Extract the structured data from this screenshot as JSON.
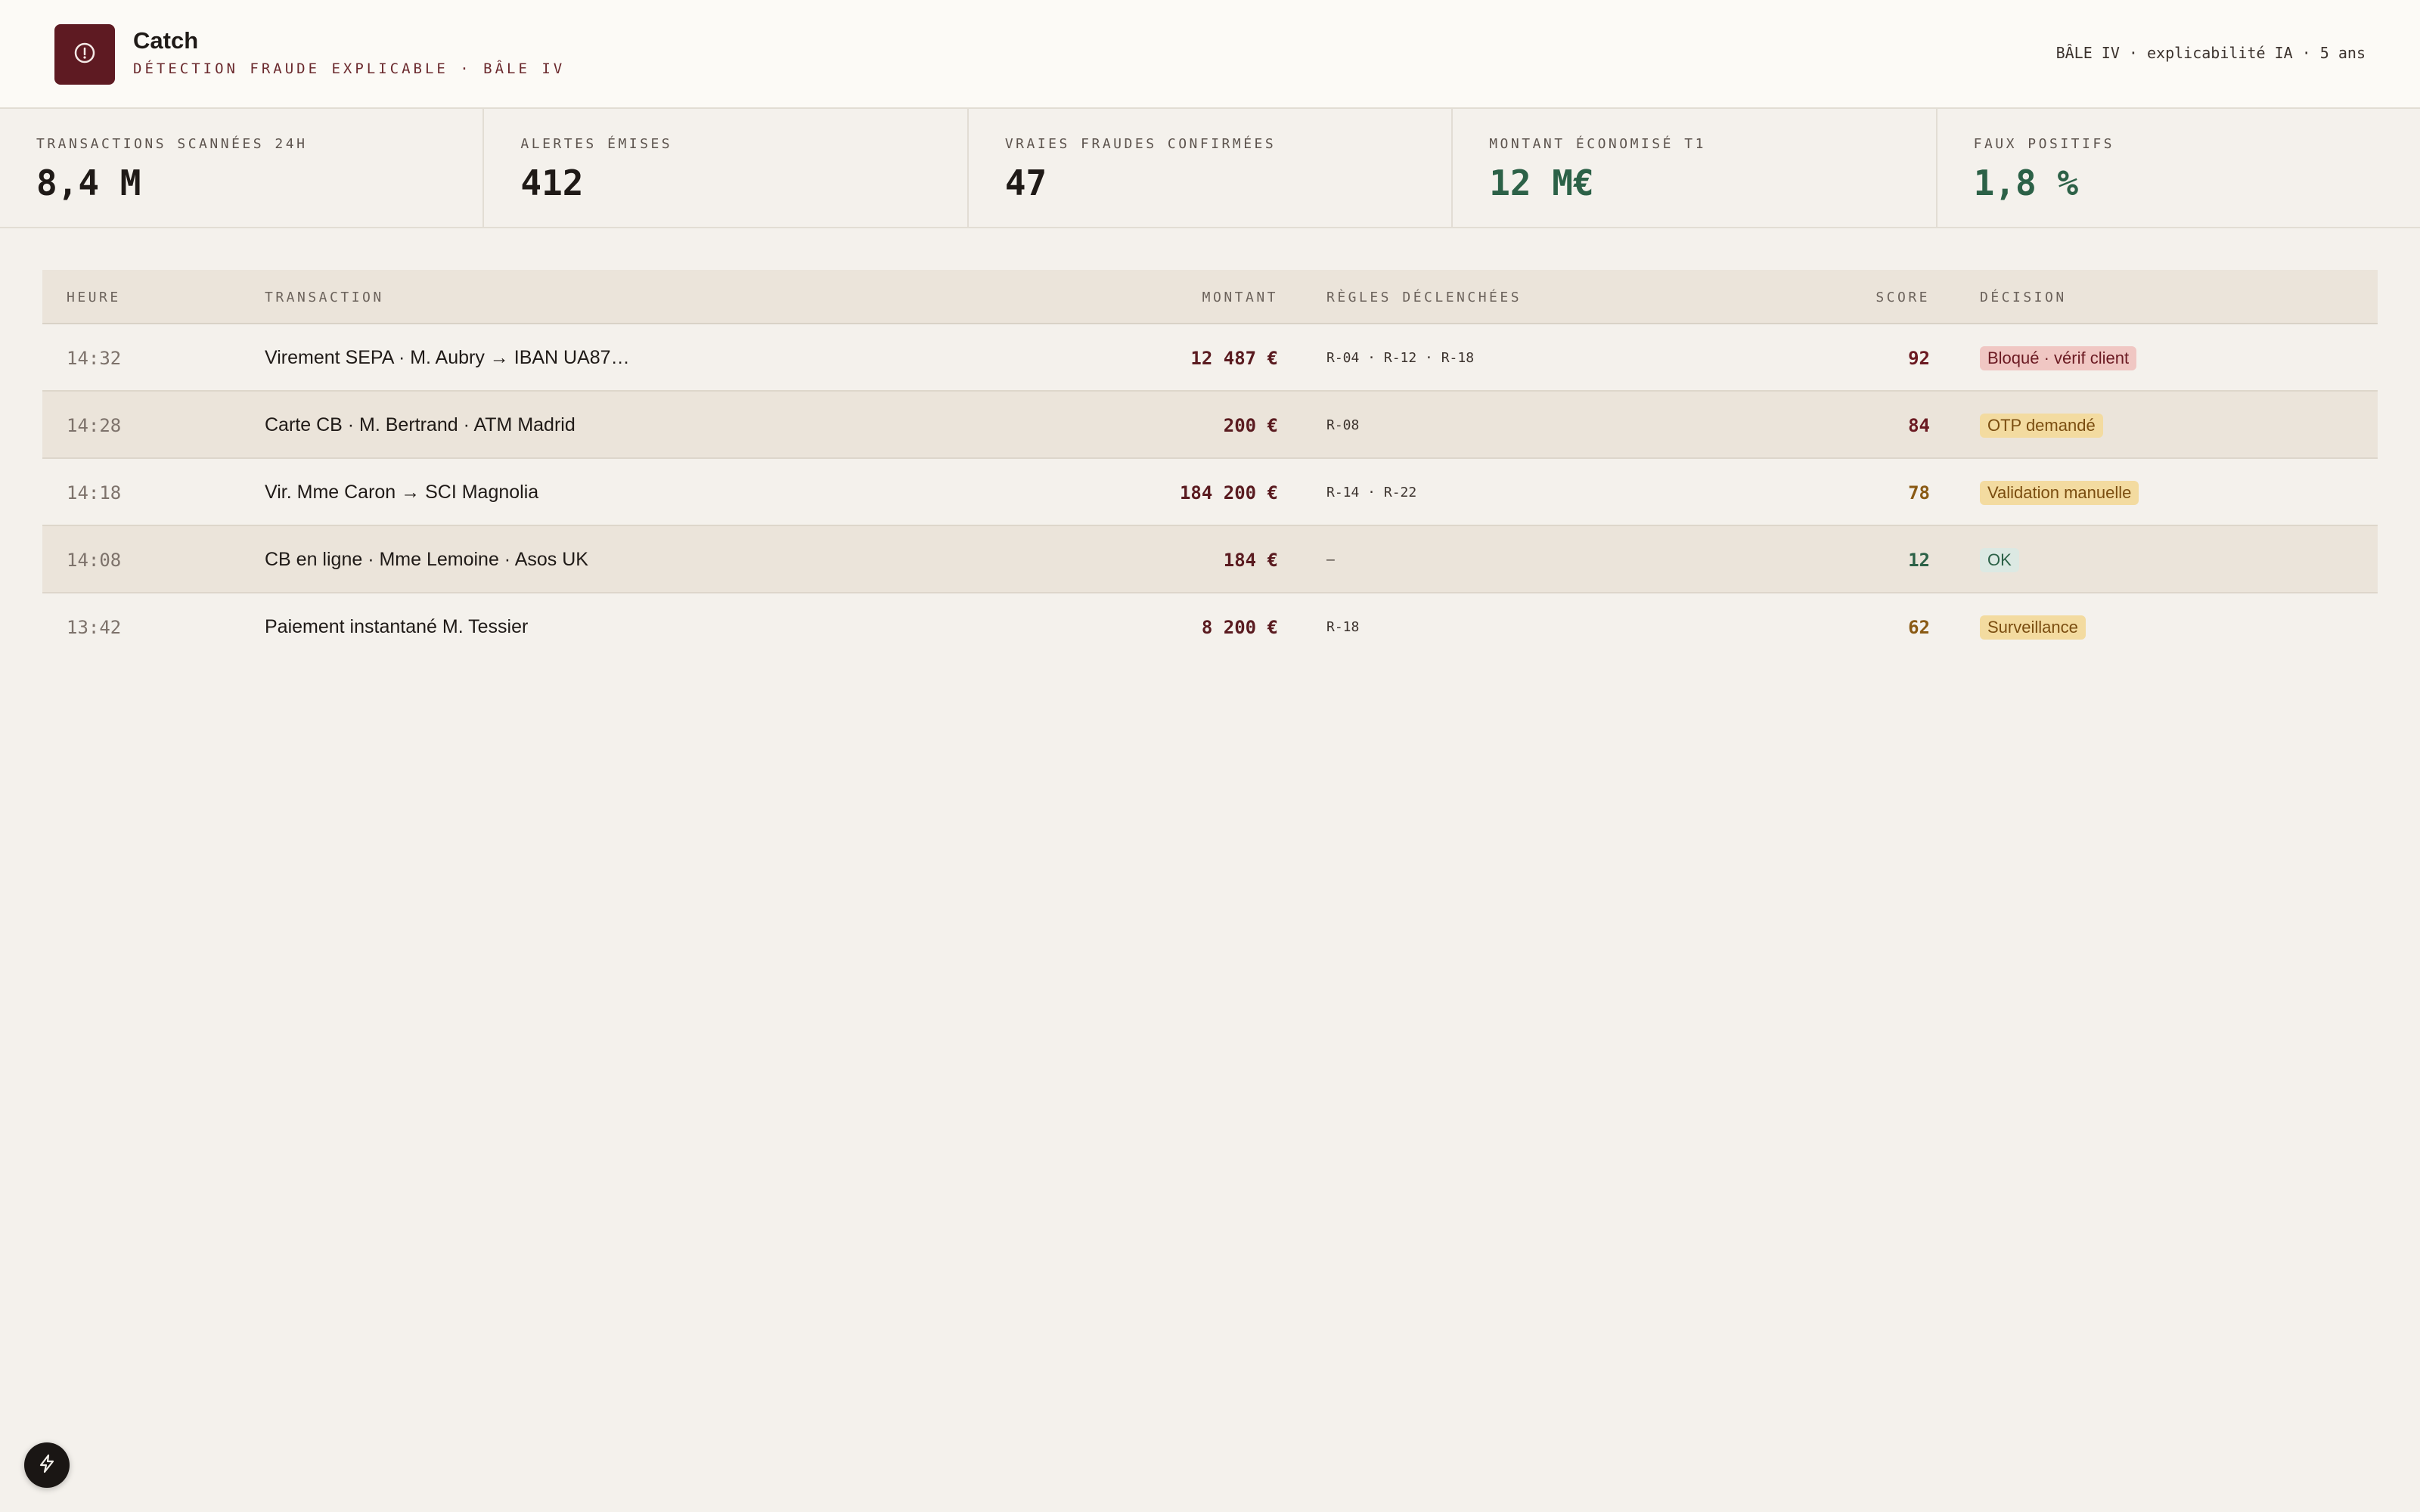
{
  "app": {
    "name": "Catch",
    "subtitle": "DÉTECTION FRAUDE EXPLICABLE · BÂLE IV",
    "meta": "BÂLE IV · explicabilité IA · 5 ans",
    "logo_icon": "alert-circle-icon",
    "accent": "#5e1a22"
  },
  "kpis": [
    {
      "label": "TRANSACTIONS SCANNÉES 24H",
      "value": "8,4 M",
      "tone": "default"
    },
    {
      "label": "ALERTES ÉMISES",
      "value": "412",
      "tone": "default"
    },
    {
      "label": "VRAIES FRAUDES CONFIRMÉES",
      "value": "47",
      "tone": "default"
    },
    {
      "label": "MONTANT ÉCONOMISÉ T1",
      "value": "12 M€",
      "tone": "green"
    },
    {
      "label": "FAUX POSITIFS",
      "value": "1,8 %",
      "tone": "green"
    }
  ],
  "table": {
    "headers": {
      "time": "HEURE",
      "transaction": "TRANSACTION",
      "amount": "MONTANT",
      "rules": "RÈGLES DÉCLENCHÉES",
      "score": "SCORE",
      "decision": "DÉCISION"
    },
    "rows": [
      {
        "time": "14:32",
        "transaction": "Virement SEPA · M. Aubry → IBAN UA87…",
        "amount": "12 487 €",
        "rules": "R-04 · R-12 · R-18",
        "score": "92",
        "score_color": "#6b1a22",
        "decision": "Bloqué · vérif client",
        "decision_tone": "red"
      },
      {
        "time": "14:28",
        "transaction": "Carte CB · M. Bertrand · ATM Madrid",
        "amount": "200 €",
        "rules": "R-08",
        "score": "84",
        "score_color": "#6b1a22",
        "decision": "OTP demandé",
        "decision_tone": "amber"
      },
      {
        "time": "14:18",
        "transaction": "Vir. Mme Caron → SCI Magnolia",
        "amount": "184 200 €",
        "rules": "R-14 · R-22",
        "score": "78",
        "score_color": "#8a5a14",
        "decision": "Validation manuelle",
        "decision_tone": "amber"
      },
      {
        "time": "14:08",
        "transaction": "CB en ligne · Mme Lemoine · Asos UK",
        "amount": "184 €",
        "rules": "–",
        "score": "12",
        "score_color": "#2c6147",
        "decision": "OK",
        "decision_tone": "green"
      },
      {
        "time": "13:42",
        "transaction": "Paiement instantané M. Tessier",
        "amount": "8 200 €",
        "rules": "R-18",
        "score": "62",
        "score_color": "#8a5a14",
        "decision": "Surveillance",
        "decision_tone": "amber"
      }
    ]
  },
  "fab": {
    "icon": "lightning-icon"
  }
}
